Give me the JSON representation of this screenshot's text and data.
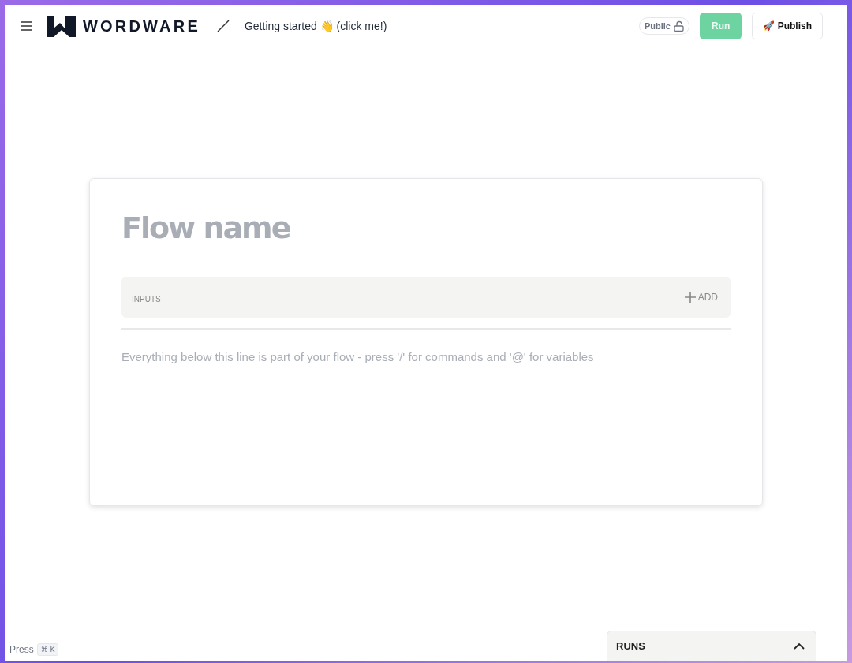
{
  "header": {
    "logo": "WORDWARE",
    "breadcrumb": "Getting started 👋 (click me!)",
    "visibility": {
      "label": "Public",
      "locked": false
    },
    "buttons": [
      {
        "kind": "run",
        "label": "Run",
        "disabled": true
      },
      {
        "kind": "publish",
        "label": "🚀 Publish",
        "disabled": false
      }
    ]
  },
  "editor": {
    "title": {
      "placeholder": "Flow name"
    },
    "inputs": {
      "label": "INPUTS",
      "add": "ADD"
    },
    "body": {
      "placeholder": "Everything below this line is part of your flow - press '/' for commands and '@' for variables"
    }
  },
  "footer": {
    "hint": "Press",
    "shortcut": "⌘ K"
  },
  "runs_panel": {
    "label": "RUNS",
    "expanded": false
  }
}
